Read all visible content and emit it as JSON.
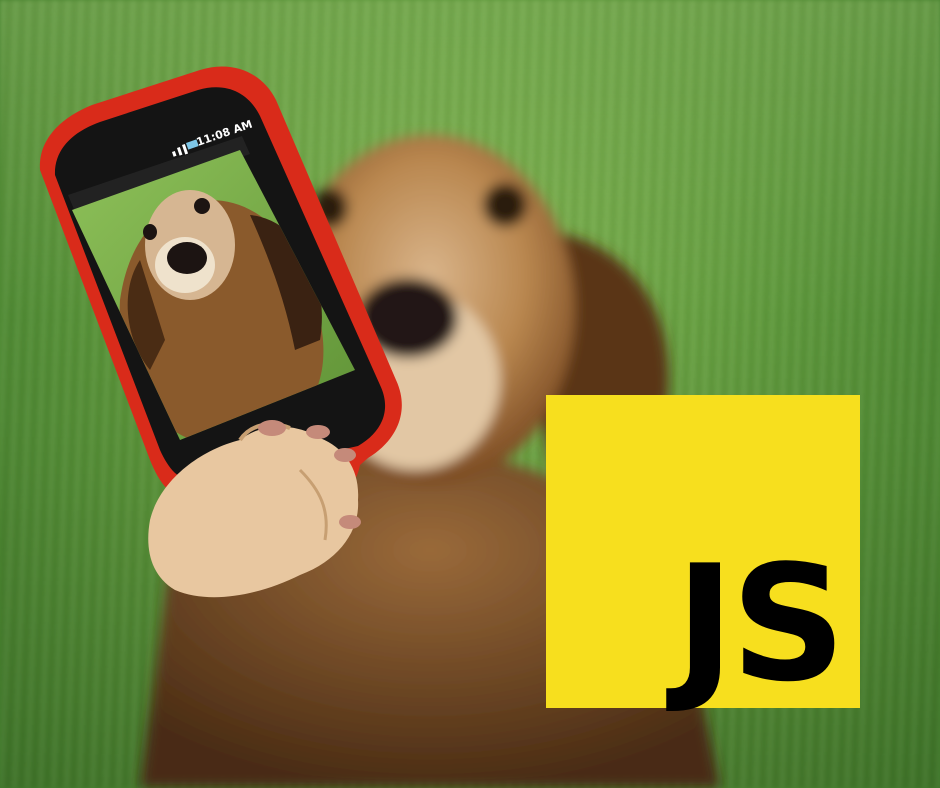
{
  "phone": {
    "status_time": "11:08 AM"
  },
  "js_logo": {
    "text": "JS",
    "background_color": "#f7df1e",
    "text_color": "#000000"
  },
  "colors": {
    "phone_frame": "#d92b1a",
    "grass": "#5f9a3c",
    "dog_fur": "#b9874f"
  },
  "icons": [
    "signal-icon",
    "battery-icon"
  ]
}
